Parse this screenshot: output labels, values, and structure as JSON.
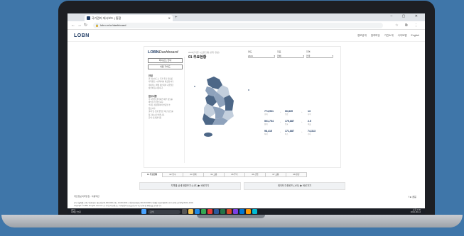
{
  "browser": {
    "tab_title": "국가관리 대시보드 | 통합",
    "url": "lobn.or.kr/dashboard",
    "new_tab": "+",
    "window_controls": "– ▢ ✕"
  },
  "site": {
    "logo": "LOBN",
    "nav": [
      "정보공개",
      "참여마당",
      "기관소개",
      "사이트맵",
      "English"
    ]
  },
  "dashboard": {
    "logo_main": "LOBN",
    "logo_sub": "Dashboard",
    "side_buttons": [
      "대시보드 안내",
      "이용 가이드"
    ],
    "side_sections": [
      {
        "head": "안내",
        "lines": [
          "본 대시보드는 국가 주요 지표를",
          "지역별로 시각화하여 제공합니다.",
          "",
          "데이터는 매월 갱신되며 기준일은",
          "상단에 표시됩니다."
        ]
      },
      {
        "head": "참고사항",
        "lines": [
          "각 지역을 클릭하면 세부 정보를",
          "확인할 수 있습니다.",
          "수치는 잠정치이며 변동될 수",
          "있습니다.",
          "출처 및 산출 방법은 하단 링크를",
          "참고하시기 바랍니다.",
          "문의: 통계관리팀"
        ]
      }
    ],
    "title_small": "2024년 기준 시도별 현황 (단위: 천명)",
    "title": "01 주요현황",
    "filters": [
      {
        "label": "연도",
        "value": "2024"
      },
      {
        "label": "지표",
        "value": "전체"
      },
      {
        "label": "지역",
        "value": "전국"
      }
    ],
    "stats": [
      {
        "value": "774,961",
        "label": "총계"
      },
      {
        "value": "66,839",
        "label": "증감"
      },
      {
        "value": "13",
        "label": "지역"
      },
      {
        "value": "501,754",
        "label": "합계"
      },
      {
        "value": "175,887",
        "label": "평균"
      },
      {
        "value": "2.5",
        "label": "비율"
      },
      {
        "value": "98,415",
        "label": "최대"
      },
      {
        "value": "171,887",
        "label": "최소"
      },
      {
        "value": "74,313",
        "label": "기타"
      }
    ],
    "bottom_tabs": [
      "01 주요현황",
      "02 인구",
      "03 경제",
      "04 고용",
      "05 주거",
      "06 산업",
      "07 교통",
      "08 환경",
      "09 복지",
      "10 기타"
    ]
  },
  "actions": {
    "left_button": "지역별 상세 현황보기 (시도) ▶ 바로가기",
    "right_button": "데이터 다운로드 (시도) ▶ 바로가기"
  },
  "footer": {
    "links": "개인정보처리방침 · 이용약관",
    "share": "f  ⊕  공유",
    "lines": [
      "(우) 서울특별시 중구 세종대로 | 대표전화 02-000-0000 | 팩스 02-000-0001 | 사업자등록번호 000-00-00000 | 이메일 support@lobn.or.kr | 운영시간 평일 09:00~18:00",
      "Copyright © LOBN. All rights reserved. 본 사이트의 콘텐츠는 저작권법의 보호를 받으며 무단 전재 및 재배포를 금지합니다."
    ]
  },
  "taskbar": {
    "weather_temp": "26°C",
    "weather_desc": "대체로 흐림",
    "search": "검색",
    "time": "오후 2:36",
    "date": "2024-06-12"
  },
  "colors": {
    "brand": "#1f3b64",
    "map_dark": "#4d6787",
    "map_mid": "#8ea2bc",
    "map_light": "#c3cfdd"
  }
}
